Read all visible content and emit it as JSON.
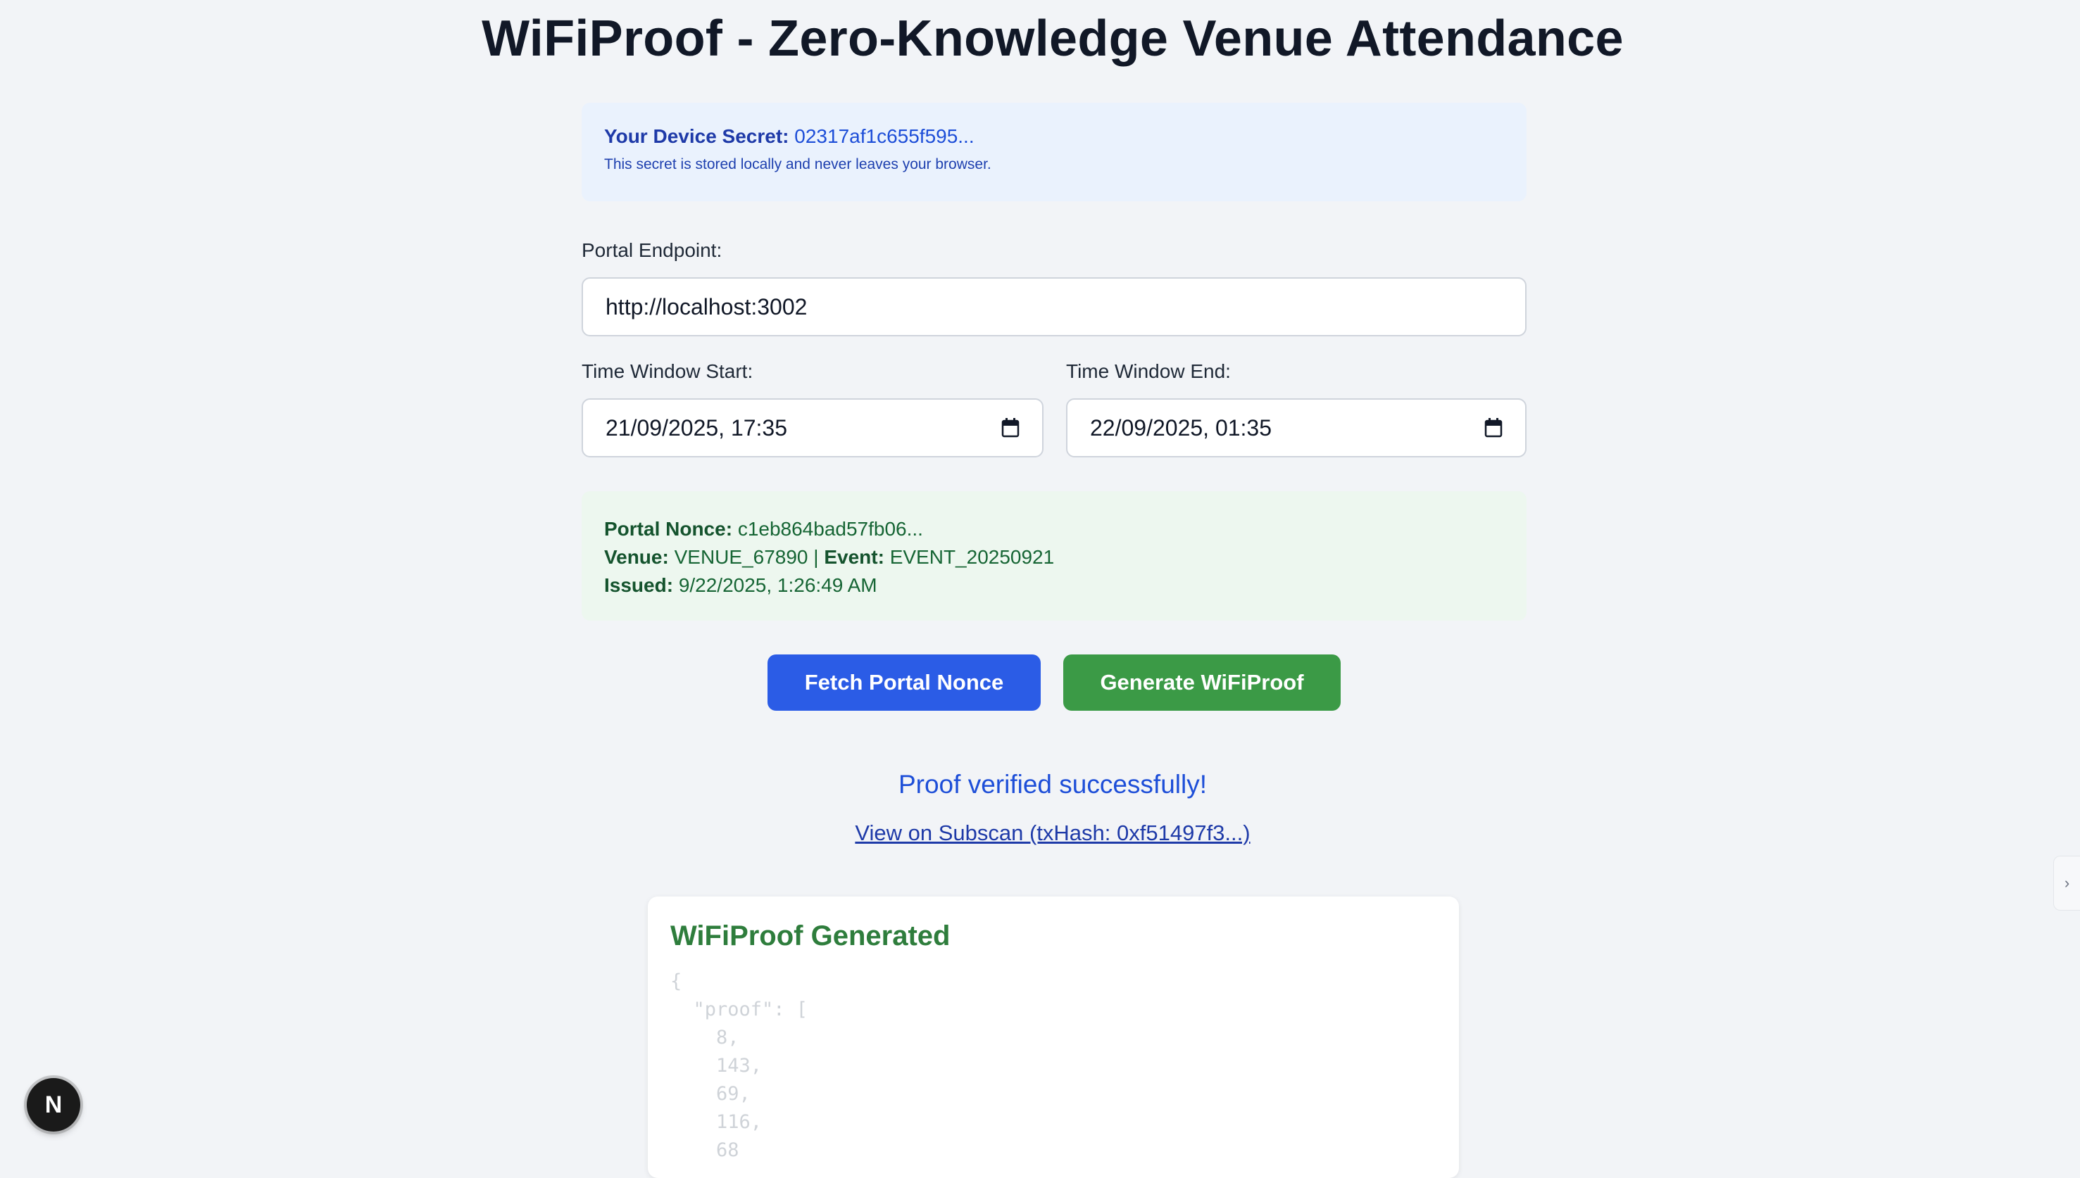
{
  "page": {
    "title": "WiFiProof - Zero-Knowledge Venue Attendance"
  },
  "device_secret": {
    "label": "Your Device Secret:",
    "value": "02317af1c655f595...",
    "note": "This secret is stored locally and never leaves your browser."
  },
  "portal_endpoint": {
    "label": "Portal Endpoint:",
    "value": "http://localhost:3002"
  },
  "time_window": {
    "start_label": "Time Window Start:",
    "start_value": "21/09/2025, 17:35",
    "end_label": "Time Window End:",
    "end_value": "22/09/2025, 01:35"
  },
  "nonce_info": {
    "nonce_label": "Portal Nonce:",
    "nonce_value": "c1eb864bad57fb06...",
    "venue_label": "Venue:",
    "venue_value": "VENUE_67890",
    "separator": "|",
    "event_label": "Event:",
    "event_value": "EVENT_20250921",
    "issued_label": "Issued:",
    "issued_value": "9/22/2025, 1:26:49 AM"
  },
  "actions": {
    "fetch_label": "Fetch Portal Nonce",
    "generate_label": "Generate WiFiProof"
  },
  "status": {
    "message": "Proof verified successfully!",
    "link_text": "View on Subscan (txHash: 0xf51497f3...)"
  },
  "proof_card": {
    "title": "WiFiProof Generated",
    "code_lines": [
      "{",
      "  \"proof\": [",
      "    8,",
      "    143,",
      "    69,",
      "    116,",
      "    68"
    ]
  },
  "dev_badge": {
    "letter": "N"
  },
  "side_tab": {
    "glyph": "›"
  },
  "colors": {
    "primary_button": "#2b5ce6",
    "success_button": "#3b9a46",
    "secret_panel": "#eaf2fd",
    "nonce_panel": "#edf7ef",
    "status_text": "#1d4ed8",
    "proof_title": "#2e7d3c"
  }
}
